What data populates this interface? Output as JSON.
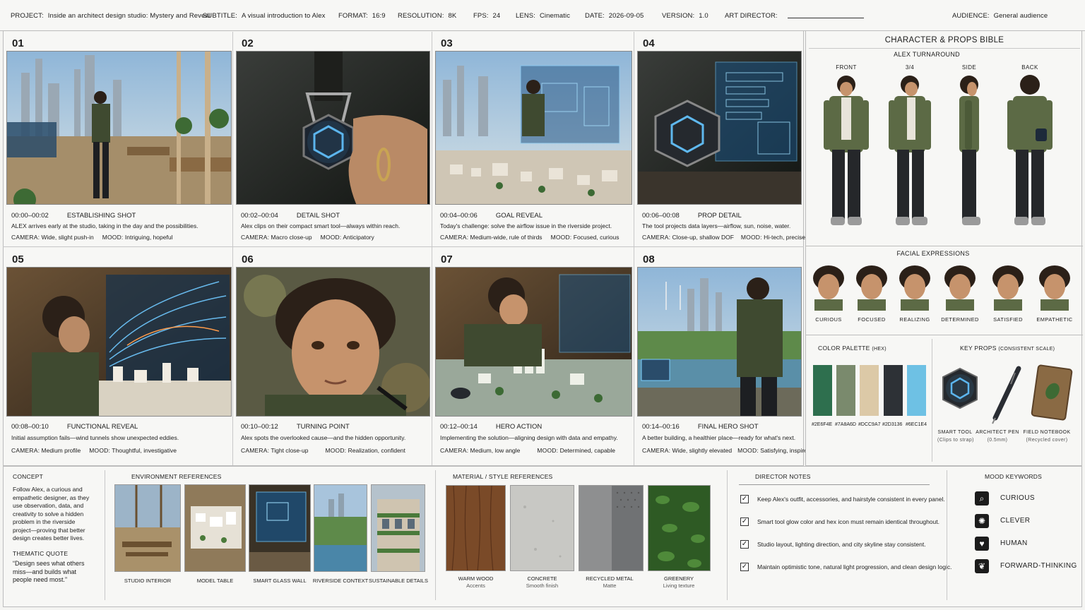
{
  "header": {
    "project_label": "PROJECT:",
    "project": "Inside an architect design studio: Mystery and Reveal",
    "subtitle_label": "SUBTITLE:",
    "subtitle": "A visual introduction to Alex",
    "format_label": "FORMAT:",
    "format": "16:9",
    "resolution_label": "RESOLUTION:",
    "resolution": "8K",
    "fps_label": "FPS:",
    "fps": "24",
    "lens_label": "LENS:",
    "lens": "Cinematic",
    "date_label": "DATE:",
    "date": "2026-09-05",
    "version_label": "VERSION:",
    "version": "1.0",
    "art_director_label": "ART DIRECTOR:",
    "audience_label": "AUDIENCE:",
    "audience": "General audience"
  },
  "panels": [
    {
      "num": "01",
      "time": "00:00–00:02",
      "shot": "ESTABLISHING SHOT",
      "desc": "ALEX arrives early at the studio, taking in the day and the possibilities.",
      "camera_label": "CAMERA:",
      "camera": "Wide, slight push-in",
      "mood_label": "MOOD:",
      "mood": "Intriguing, hopeful"
    },
    {
      "num": "02",
      "time": "00:02–00:04",
      "shot": "DETAIL SHOT",
      "desc": "Alex clips on their compact smart tool—always within reach.",
      "camera_label": "CAMERA:",
      "camera": "Macro close-up",
      "mood_label": "MOOD:",
      "mood": "Anticipatory"
    },
    {
      "num": "03",
      "time": "00:04–00:06",
      "shot": "GOAL REVEAL",
      "desc": "Today's challenge: solve the airflow issue in the riverside project.",
      "camera_label": "CAMERA:",
      "camera": "Medium-wide, rule of thirds",
      "mood_label": "MOOD:",
      "mood": "Focused, curious"
    },
    {
      "num": "04",
      "time": "00:06–00:08",
      "shot": "PROP DETAIL",
      "desc": "The tool projects data layers—airflow, sun, noise, water.",
      "camera_label": "CAMERA:",
      "camera": "Close-up, shallow DOF",
      "mood_label": "MOOD:",
      "mood": "Hi-tech, precise"
    },
    {
      "num": "05",
      "time": "00:08–00:10",
      "shot": "FUNCTIONAL REVEAL",
      "desc": "Initial assumption fails—wind tunnels show unexpected eddies.",
      "camera_label": "CAMERA:",
      "camera": "Medium profile",
      "mood_label": "MOOD:",
      "mood": "Thoughtful, investigative"
    },
    {
      "num": "06",
      "time": "00:10–00:12",
      "shot": "TURNING POINT",
      "desc": "Alex spots the overlooked cause—and the hidden opportunity.",
      "camera_label": "CAMERA:",
      "camera": "Tight close-up",
      "mood_label": "MOOD:",
      "mood": "Realization, confident"
    },
    {
      "num": "07",
      "time": "00:12–00:14",
      "shot": "HERO ACTION",
      "desc": "Implementing the solution—aligning design with data and empathy.",
      "camera_label": "CAMERA:",
      "camera": "Medium, low angle",
      "mood_label": "MOOD:",
      "mood": "Determined, capable"
    },
    {
      "num": "08",
      "time": "00:14–00:16",
      "shot": "FINAL HERO SHOT",
      "desc": "A better building, a healthier place—ready for what's next.",
      "camera_label": "CAMERA:",
      "camera": "Wide, slightly elevated",
      "mood_label": "MOOD:",
      "mood": "Satisfying, inspired"
    }
  ],
  "bible": {
    "title": "CHARACTER & PROPS BIBLE",
    "turnaround_title": "ALEX TURNAROUND",
    "views": [
      "FRONT",
      "3/4",
      "SIDE",
      "BACK"
    ],
    "expressions_title": "FACIAL EXPRESSIONS",
    "expressions": [
      "CURIOUS",
      "FOCUSED",
      "REALIZING",
      "DETERMINED",
      "SATISFIED",
      "EMPATHETIC"
    ],
    "palette_title": "COLOR PALETTE",
    "palette_suffix": "(HEX)",
    "palette": [
      {
        "hex": "#2E6F4E",
        "color": "#2E6F4E"
      },
      {
        "hex": "#7A8A6D",
        "color": "#7A8A6D"
      },
      {
        "hex": "#DCC9A7",
        "color": "#DCC9A7"
      },
      {
        "hex": "#2D3136",
        "color": "#2D3136"
      },
      {
        "hex": "#6EC1E4",
        "color": "#6EC1E4"
      }
    ],
    "props_title": "KEY PROPS",
    "props_suffix": "(CONSISTENT SCALE)",
    "props": [
      {
        "name": "SMART TOOL",
        "note": "(Clips to strap)"
      },
      {
        "name": "ARCHITECT PEN",
        "note": "(0.5mm)"
      },
      {
        "name": "FIELD NOTEBOOK",
        "note": "(Recycled cover)"
      }
    ]
  },
  "concept": {
    "title": "CONCEPT",
    "lines": [
      "Follow Alex, a curious and",
      "empathetic designer, as they",
      "use observation, data, and",
      "creativity to solve a hidden",
      "problem in the riverside",
      "project—proving that better",
      "design creates better lives."
    ],
    "quote_title": "THEMATIC QUOTE",
    "quote_lines": [
      "“Design sees what others",
      "miss—and builds what",
      "people need most.”"
    ]
  },
  "environment": {
    "title": "ENVIRONMENT REFERENCES",
    "items": [
      "STUDIO INTERIOR",
      "MODEL TABLE",
      "SMART GLASS WALL",
      "RIVERSIDE CONTEXT",
      "SUSTAINABLE DETAILS"
    ]
  },
  "materials": {
    "title": "MATERIAL / STYLE REFERENCES",
    "items": [
      {
        "name": "WARM WOOD",
        "note": "Accents"
      },
      {
        "name": "CONCRETE",
        "note": "Smooth finish"
      },
      {
        "name": "RECYCLED METAL",
        "note": "Matte"
      },
      {
        "name": "GREENERY",
        "note": "Living texture"
      }
    ]
  },
  "director_notes": {
    "title": "DIRECTOR NOTES",
    "items": [
      "Keep Alex's outfit, accessories, and hairstyle consistent in every panel.",
      "Smart tool glow color and hex icon must remain identical throughout.",
      "Studio layout, lighting direction, and city skyline stay consistent.",
      "Maintain optimistic tone, natural light progression, and clean design logic."
    ],
    "checkmark": "✓"
  },
  "mood_keywords": {
    "title": "MOOD KEYWORDS",
    "items": [
      {
        "icon": "search-icon",
        "glyph": "⌕",
        "label": "CURIOUS"
      },
      {
        "icon": "lightbulb-icon",
        "glyph": "✺",
        "label": "CLEVER"
      },
      {
        "icon": "heart-icon",
        "glyph": "♥",
        "label": "HUMAN"
      },
      {
        "icon": "leaf-icon",
        "glyph": "❦",
        "label": "FORWARD-THINKING"
      }
    ]
  }
}
